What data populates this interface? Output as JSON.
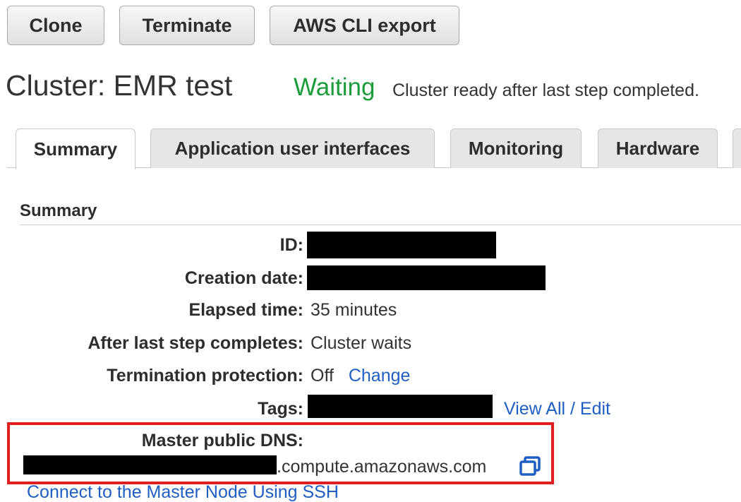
{
  "toolbar": {
    "clone_label": "Clone",
    "terminate_label": "Terminate",
    "cli_export_label": "AWS CLI export"
  },
  "cluster": {
    "title": "Cluster: EMR test",
    "state": "Waiting",
    "state_message": "Cluster ready after last step completed."
  },
  "tabs": [
    {
      "label": "Summary",
      "active": true
    },
    {
      "label": "Application user interfaces",
      "active": false
    },
    {
      "label": "Monitoring",
      "active": false
    },
    {
      "label": "Hardware",
      "active": false
    }
  ],
  "summary": {
    "heading": "Summary",
    "id_label": "ID:",
    "creation_date_label": "Creation date:",
    "elapsed_time_label": "Elapsed time:",
    "elapsed_time_value": "35 minutes",
    "after_last_step_label": "After last step completes:",
    "after_last_step_value": "Cluster waits",
    "termination_protection_label": "Termination protection:",
    "termination_protection_value": "Off",
    "termination_protection_change": "Change",
    "tags_label": "Tags:",
    "tags_view_all": "View All / Edit",
    "master_dns_label": "Master public DNS:",
    "master_dns_suffix": ".compute.amazonaws.com",
    "ssh_link": "Connect to the Master Node Using SSH"
  },
  "colors": {
    "status_green": "#1a9c3a",
    "link_blue": "#1f5fc4",
    "highlight_red": "#e02020"
  },
  "icons": {
    "copy": "copy-icon"
  }
}
